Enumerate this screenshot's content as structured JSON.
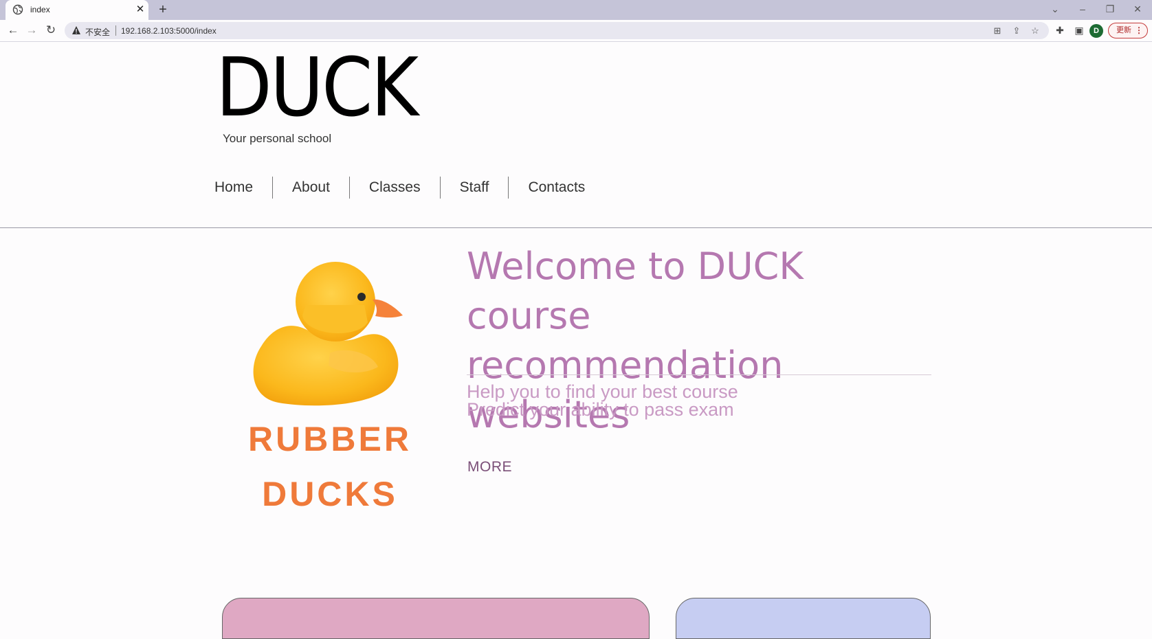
{
  "browser": {
    "tab_title": "index",
    "tab_close": "✕",
    "new_tab": "+",
    "security_label": "不安全",
    "url": "192.168.2.103:5000/index",
    "profile_initial": "D",
    "update_label": "更新",
    "update_menu": "⋮"
  },
  "site": {
    "logo": "DUCK",
    "tagline": "Your personal school",
    "nav": [
      "Home",
      "About",
      "Classes",
      "Staff",
      "Contacts"
    ]
  },
  "hero": {
    "image_text_line1": "RUBBER",
    "image_text_line2": "DUCKS",
    "headline_line1": "Welcome to DUCK course",
    "headline_line2": "recommendation websites",
    "subline1": "Help you to find your best course",
    "subline2": "Predict your ability to pass exam",
    "more": "MORE"
  },
  "colors": {
    "accent_text": "#b578b0",
    "sub_text": "#c99ac4",
    "more_link": "#7b4f78",
    "card_pink": "#dfa8c3",
    "card_blue": "#c6cdf2"
  }
}
